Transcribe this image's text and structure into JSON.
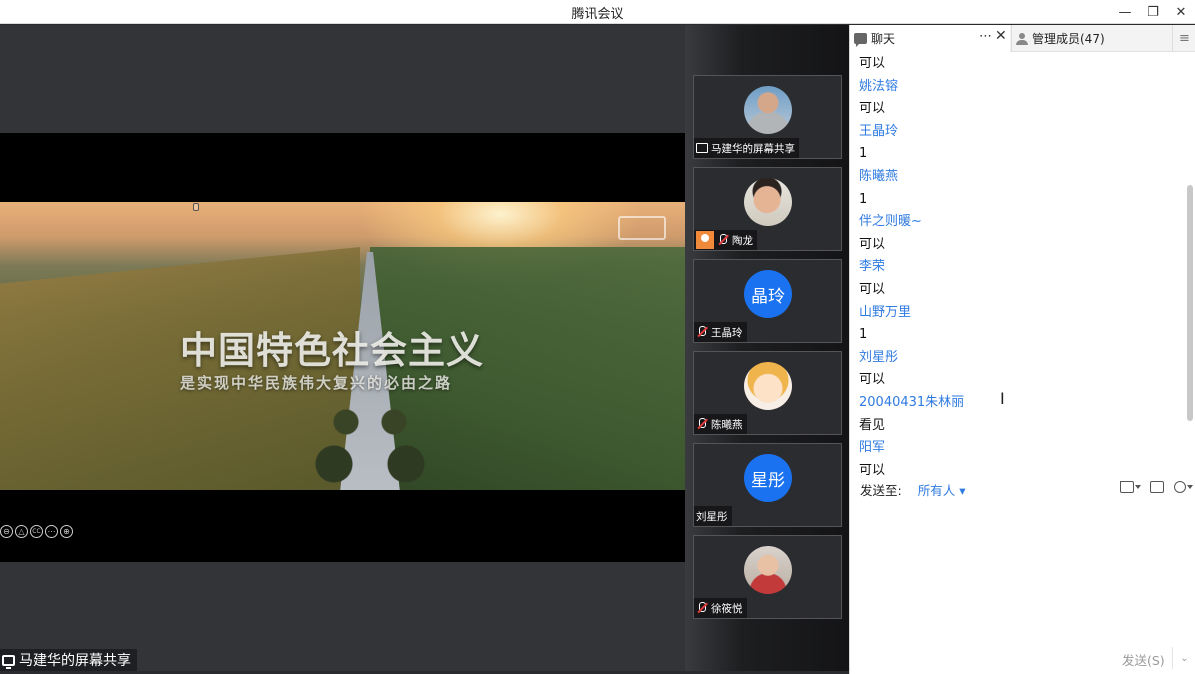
{
  "window": {
    "title": "腾讯会议",
    "minimize": "—",
    "restore": "❐",
    "close": "✕"
  },
  "share": {
    "video_title": "中国特色社会主义",
    "video_subtitle": "是实现中华民族伟大复兴的必由之路",
    "presenter_label": "马建华的屏幕共享",
    "controls": [
      "⊖",
      "△",
      "CC",
      "⋯",
      "⊕"
    ]
  },
  "participants": [
    {
      "name": "马建华的屏幕共享",
      "avatar": "photo1",
      "status": "screen-share"
    },
    {
      "name": "陶龙",
      "avatar": "photo2",
      "status": "host-muted"
    },
    {
      "name": "王晶玲",
      "avatar": "initials",
      "initials": "晶玲",
      "status": "muted"
    },
    {
      "name": "陈曦燕",
      "avatar": "cartoon",
      "status": "muted"
    },
    {
      "name": "刘星彤",
      "avatar": "initials",
      "initials": "星彤",
      "status": "none"
    },
    {
      "name": "徐筱悦",
      "avatar": "photo3",
      "status": "muted"
    }
  ],
  "chat": {
    "tab_chat": "聊天",
    "tab_more": "⋯",
    "tab_close": "✕",
    "tab_members": "管理成员(47)",
    "tab_menu": "≡",
    "messages": [
      {
        "type": "text",
        "value": "可以"
      },
      {
        "type": "name",
        "value": "姚法镕"
      },
      {
        "type": "text",
        "value": "可以"
      },
      {
        "type": "name",
        "value": "王晶玲"
      },
      {
        "type": "text",
        "value": "1"
      },
      {
        "type": "name",
        "value": "陈曦燕"
      },
      {
        "type": "text",
        "value": "1"
      },
      {
        "type": "name",
        "value": "伴之则暖~"
      },
      {
        "type": "text",
        "value": "可以"
      },
      {
        "type": "name",
        "value": "李荣"
      },
      {
        "type": "text",
        "value": "可以"
      },
      {
        "type": "name",
        "value": "山野万里"
      },
      {
        "type": "text",
        "value": "1"
      },
      {
        "type": "name",
        "value": "刘星彤"
      },
      {
        "type": "text",
        "value": "可以"
      },
      {
        "type": "name",
        "value": "20040431朱林丽"
      },
      {
        "type": "text",
        "value": "看见"
      },
      {
        "type": "name",
        "value": "阳军"
      },
      {
        "type": "text",
        "value": "可以"
      }
    ],
    "send_to_label": "发送至:",
    "send_to_value": "所有人 ▾",
    "send_button": "发送(S)",
    "send_caret": "⌄"
  },
  "colors": {
    "accent_blue": "#1a72f0",
    "name_blue": "#2f7be0",
    "host_orange": "#f08a3a"
  }
}
